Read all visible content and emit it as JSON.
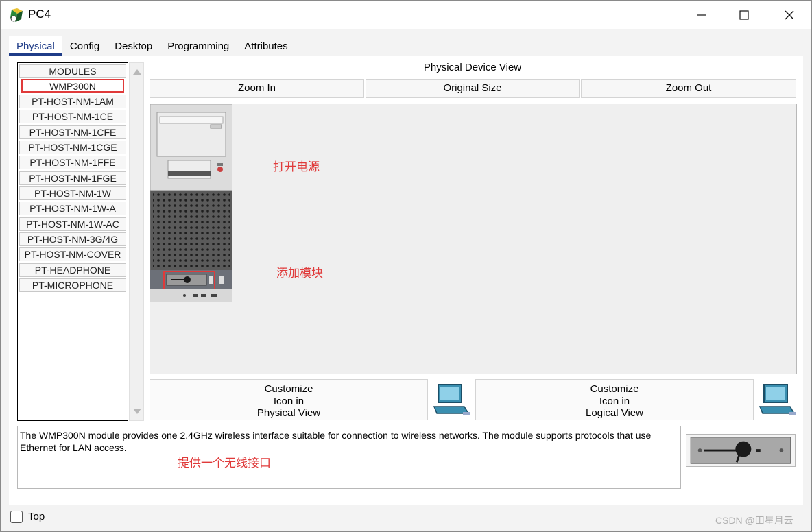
{
  "window": {
    "title": "PC4"
  },
  "tabs": [
    {
      "label": "Physical",
      "active": true
    },
    {
      "label": "Config"
    },
    {
      "label": "Desktop"
    },
    {
      "label": "Programming"
    },
    {
      "label": "Attributes"
    }
  ],
  "modules": {
    "header": "MODULES",
    "items": [
      "WMP300N",
      "PT-HOST-NM-1AM",
      "PT-HOST-NM-1CE",
      "PT-HOST-NM-1CFE",
      "PT-HOST-NM-1CGE",
      "PT-HOST-NM-1FFE",
      "PT-HOST-NM-1FGE",
      "PT-HOST-NM-1W",
      "PT-HOST-NM-1W-A",
      "PT-HOST-NM-1W-AC",
      "PT-HOST-NM-3G/4G",
      "PT-HOST-NM-COVER",
      "PT-HEADPHONE",
      "PT-MICROPHONE"
    ],
    "selected": "WMP300N"
  },
  "device_view": {
    "title": "Physical Device View",
    "zoom_in": "Zoom In",
    "original_size": "Original Size",
    "zoom_out": "Zoom Out",
    "annotation_power": "打开电源",
    "annotation_module": "添加模块"
  },
  "customize": {
    "physical": [
      "Customize",
      "Icon in",
      "Physical View"
    ],
    "logical": [
      "Customize",
      "Icon in",
      "Logical View"
    ]
  },
  "description": {
    "text": "The WMP300N module provides one 2.4GHz wireless interface suitable for connection to wireless networks. The module supports protocols that use Ethernet for LAN access.",
    "annotation": "提供一个无线接口"
  },
  "footer": {
    "top_label": "Top",
    "watermark": "CSDN @田星月云"
  },
  "colors": {
    "annotation": "#e03a3a",
    "tab_active": "#1f3c88"
  }
}
